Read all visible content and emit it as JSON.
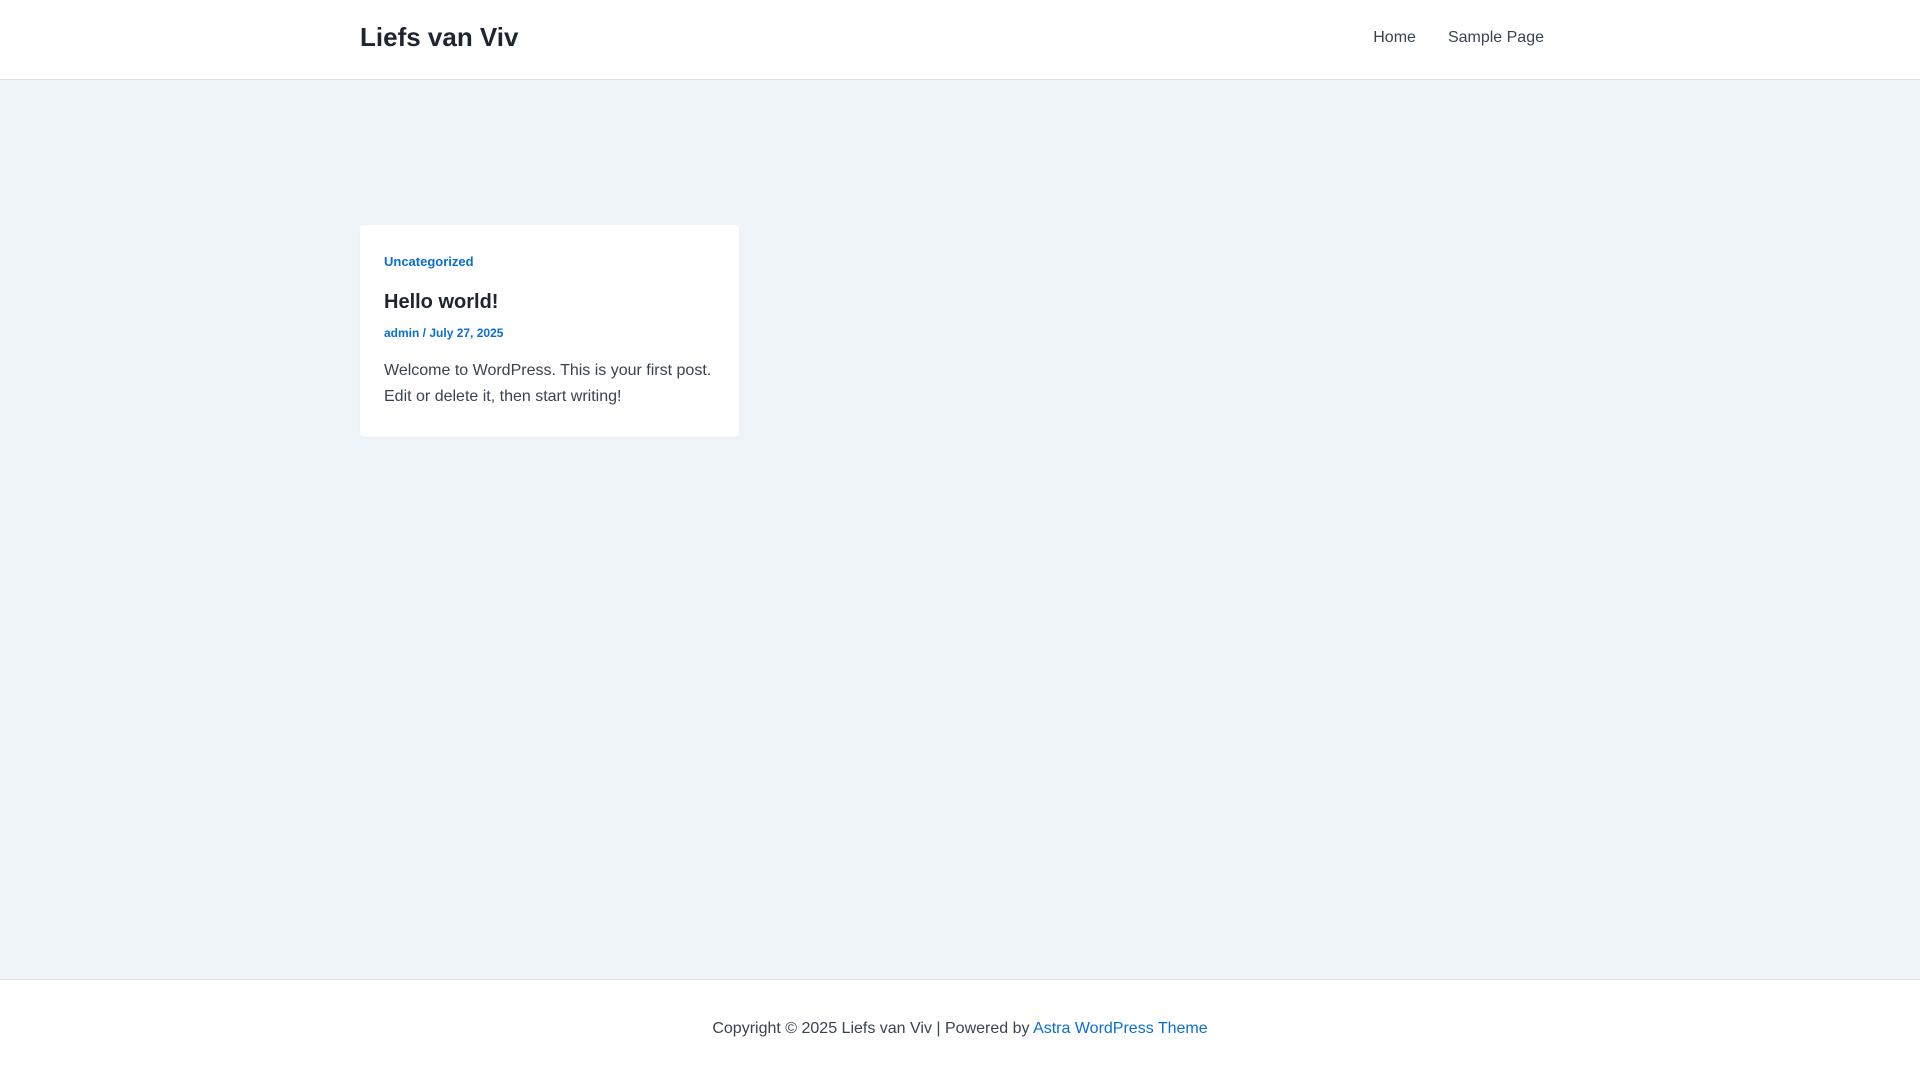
{
  "header": {
    "site_title": "Liefs van Viv",
    "nav": [
      {
        "label": "Home"
      },
      {
        "label": "Sample Page"
      }
    ]
  },
  "post": {
    "category": "Uncategorized",
    "title": "Hello world!",
    "author": "admin",
    "separator": " / ",
    "date": "July 27, 2025",
    "excerpt": "Welcome to WordPress. This is your first post. Edit or delete it, then start writing!"
  },
  "footer": {
    "copyright": "Copyright © 2025 Liefs van Viv | Powered by ",
    "theme_link": "Astra WordPress Theme"
  },
  "colors": {
    "accent": "#0a6fd1",
    "page_background": "#eff4f8",
    "heading": "#1e2430",
    "text": "#3a4350"
  }
}
